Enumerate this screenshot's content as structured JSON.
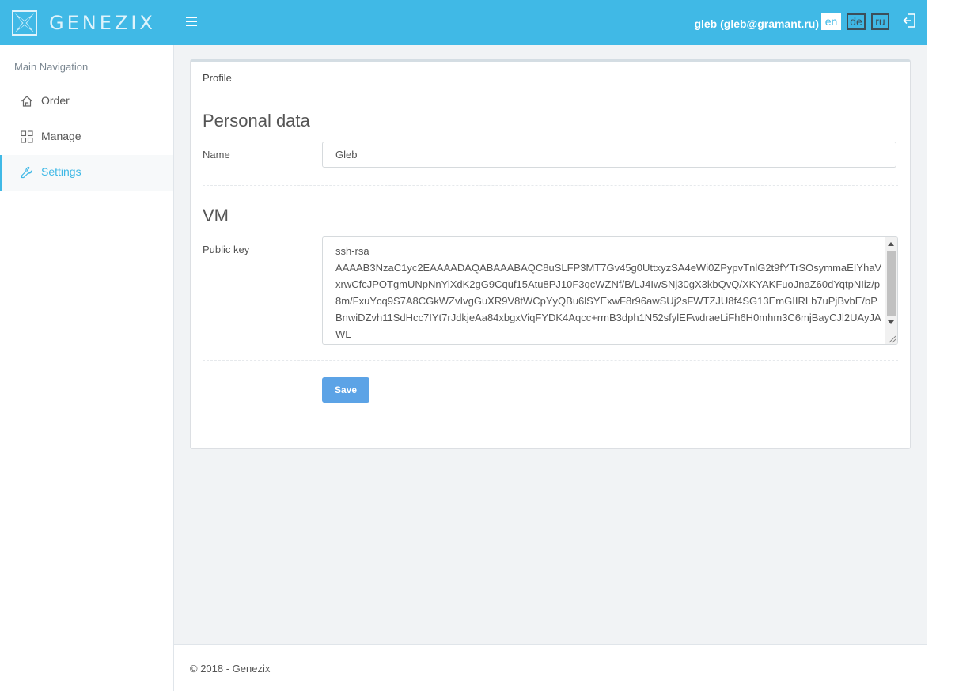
{
  "header": {
    "brand": "GENEZIX",
    "user": "gleb (gleb@gramant.ru)",
    "languages": [
      {
        "code": "en",
        "active": true
      },
      {
        "code": "de",
        "active": false
      },
      {
        "code": "ru",
        "active": false
      }
    ],
    "accent_color": "#40b9e6"
  },
  "sidebar": {
    "heading": "Main Navigation",
    "items": [
      {
        "label": "Order",
        "icon": "home-icon",
        "active": false
      },
      {
        "label": "Manage",
        "icon": "grid-icon",
        "active": false
      },
      {
        "label": "Settings",
        "icon": "wrench-icon",
        "active": true
      }
    ]
  },
  "profile": {
    "card_title": "Profile",
    "personal_section": "Personal data",
    "name_label": "Name",
    "name_value": "Gleb",
    "vm_section": "VM",
    "public_key_label": "Public key",
    "public_key_value": "ssh-rsa\nAAAAB3NzaC1yc2EAAAADAQABAAABAQC8uSLFP3MT7Gv45g0UttxyzSA4eWi0ZPypvTnlG2t9fYTrSOsymmaEIYhaVxrwCfcJPOTgmUNpNnYiXdK2gG9Cquf15Atu8PJ10F3qcWZNf/B/LJ4IwSNj30gX3kbQvQ/XKYAKFuoJnaZ60dYqtpNIiz/p8m/FxuYcq9S7A8CGkWZvIvgGuXR9V8tWCpYyQBu6lSYExwF8r96awSUj2sFWTZJU8f4SG13EmGIIRLb7uPjBvbE/bPBnwiDZvh11SdHcc7IYt7rJdkjeAa84xbgxViqFYDK4Aqcc+rmB3dph1N52sfylEFwdraeLiFh6H0mhm3C6mjBayCJl2UAyJAWL\ngilinykh@genezix.com",
    "save_label": "Save"
  },
  "footer": {
    "text": "© 2018 - Genezix"
  }
}
